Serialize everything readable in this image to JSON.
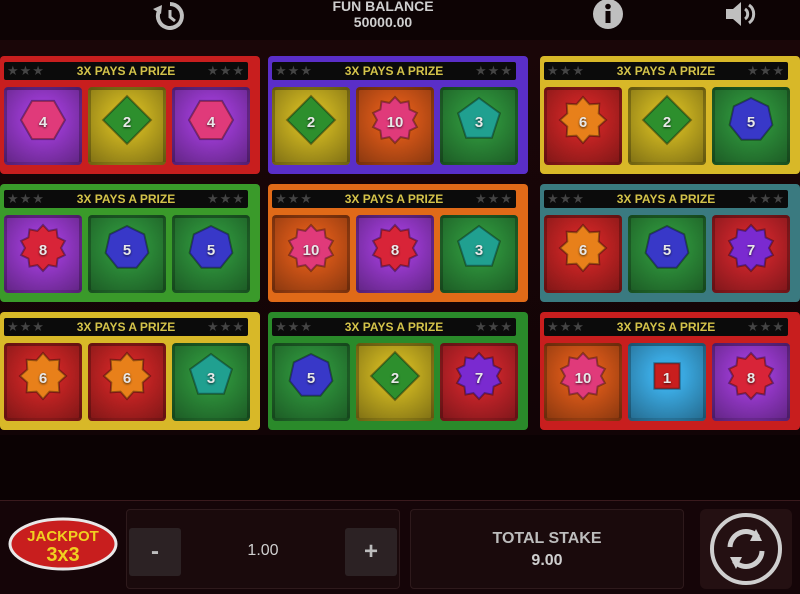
{
  "header": {
    "balance_label": "FUN BALANCE",
    "balance_value": "50000.00"
  },
  "icons": {
    "history": "history-icon",
    "info": "info-icon",
    "sound": "speaker-icon",
    "spin": "refresh-icon"
  },
  "cards": [
    {
      "banner": "3X PAYS A PRIZE",
      "frame": "#c81e1e",
      "tiles": [
        {
          "num": "4",
          "shape": "hexagon",
          "bg": "#9a3ad0",
          "fg": "#e03a7a"
        },
        {
          "num": "2",
          "shape": "diamond",
          "bg": "#c8b020",
          "fg": "#2d8f2d"
        },
        {
          "num": "4",
          "shape": "hexagon",
          "bg": "#9a3ad0",
          "fg": "#e03a7a"
        }
      ]
    },
    {
      "banner": "3X PAYS A PRIZE",
      "frame": "#5a2ec8",
      "tiles": [
        {
          "num": "2",
          "shape": "diamond",
          "bg": "#c8b020",
          "fg": "#2d8f2d"
        },
        {
          "num": "10",
          "shape": "star",
          "bg": "#d85818",
          "fg": "#e03a7a"
        },
        {
          "num": "3",
          "shape": "pentagon",
          "bg": "#2d8f3a",
          "fg": "#20a090"
        }
      ]
    },
    {
      "banner": "3X PAYS A PRIZE",
      "frame": "#d8b828",
      "tiles": [
        {
          "num": "6",
          "shape": "star8",
          "bg": "#c82424",
          "fg": "#e8801a"
        },
        {
          "num": "2",
          "shape": "diamond",
          "bg": "#c8b020",
          "fg": "#2d8f2d"
        },
        {
          "num": "5",
          "shape": "heptagon",
          "bg": "#2d8f3a",
          "fg": "#3838c8"
        }
      ]
    },
    {
      "banner": "3X PAYS A PRIZE",
      "frame": "#3a9a2a",
      "tiles": [
        {
          "num": "8",
          "shape": "star",
          "bg": "#9a3ad0",
          "fg": "#d82438"
        },
        {
          "num": "5",
          "shape": "heptagon",
          "bg": "#2d8f3a",
          "fg": "#3838c8"
        },
        {
          "num": "5",
          "shape": "heptagon",
          "bg": "#2d8f3a",
          "fg": "#3838c8"
        }
      ]
    },
    {
      "banner": "3X PAYS A PRIZE",
      "frame": "#e06a18",
      "tiles": [
        {
          "num": "10",
          "shape": "star",
          "bg": "#d85818",
          "fg": "#e03a7a"
        },
        {
          "num": "8",
          "shape": "star",
          "bg": "#9a3ad0",
          "fg": "#d82438"
        },
        {
          "num": "3",
          "shape": "pentagon",
          "bg": "#2d8f3a",
          "fg": "#20a090"
        }
      ]
    },
    {
      "banner": "3X PAYS A PRIZE",
      "frame": "#3a7a80",
      "tiles": [
        {
          "num": "6",
          "shape": "star8",
          "bg": "#c82424",
          "fg": "#e8801a"
        },
        {
          "num": "5",
          "shape": "heptagon",
          "bg": "#2d8f3a",
          "fg": "#3838c8"
        },
        {
          "num": "7",
          "shape": "star",
          "bg": "#c8242a",
          "fg": "#7a2ad0"
        }
      ]
    },
    {
      "banner": "3X PAYS A PRIZE",
      "frame": "#d8b828",
      "tiles": [
        {
          "num": "6",
          "shape": "star8",
          "bg": "#c82424",
          "fg": "#e8801a"
        },
        {
          "num": "6",
          "shape": "star8",
          "bg": "#c82424",
          "fg": "#e8801a"
        },
        {
          "num": "3",
          "shape": "pentagon",
          "bg": "#2d8f3a",
          "fg": "#20a090"
        }
      ]
    },
    {
      "banner": "3X PAYS A PRIZE",
      "frame": "#2a8a2a",
      "tiles": [
        {
          "num": "5",
          "shape": "heptagon",
          "bg": "#2d8f3a",
          "fg": "#3838c8"
        },
        {
          "num": "2",
          "shape": "diamond",
          "bg": "#c8b020",
          "fg": "#2d8f2d"
        },
        {
          "num": "7",
          "shape": "star",
          "bg": "#c8242a",
          "fg": "#7a2ad0"
        }
      ]
    },
    {
      "banner": "3X PAYS A PRIZE",
      "frame": "#c81e1e",
      "tiles": [
        {
          "num": "10",
          "shape": "star",
          "bg": "#d85818",
          "fg": "#e03a7a"
        },
        {
          "num": "1",
          "shape": "square",
          "bg": "#3aa8e0",
          "fg": "#c81e1e"
        },
        {
          "num": "8",
          "shape": "star",
          "bg": "#9a3ad0",
          "fg": "#d82438"
        }
      ]
    }
  ],
  "controls": {
    "logo_line1": "JACKPOT",
    "logo_line2": "3x3",
    "minus_label": "-",
    "plus_label": "+",
    "stake_value": "1.00",
    "total_label": "TOTAL STAKE",
    "total_value": "9.00"
  }
}
